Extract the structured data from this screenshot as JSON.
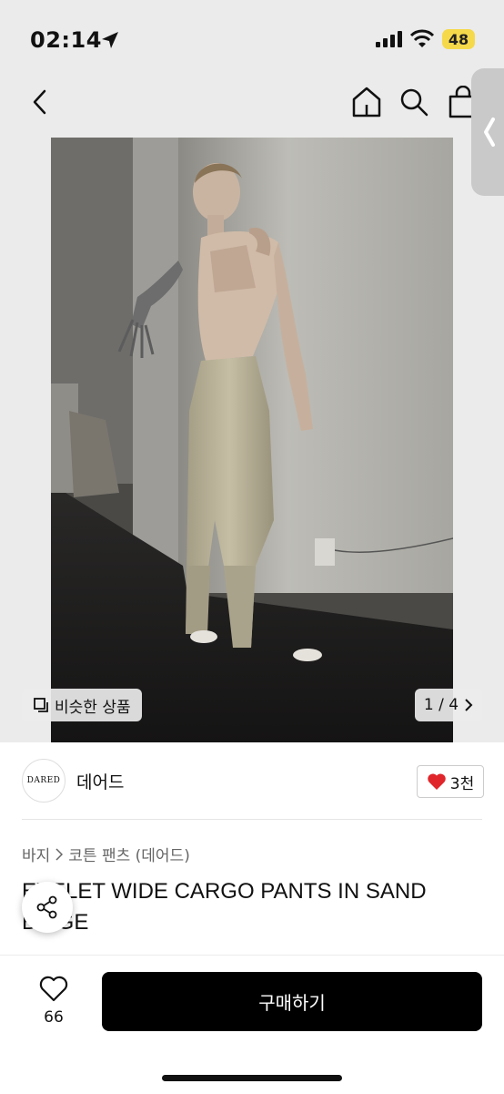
{
  "status_bar": {
    "time": "02:14",
    "battery": "48"
  },
  "overlay": {
    "similar_label": "비슷한 상품",
    "page_indicator": "1 / 4"
  },
  "brand": {
    "logo_text": "DARED",
    "name": "데어드",
    "likes": "3천"
  },
  "breadcrumb": {
    "category": "바지",
    "subcategory": "코튼 팬츠 (데어드)"
  },
  "product": {
    "title": "EYELET WIDE CARGO PANTS IN SAND BEIGE"
  },
  "bottom": {
    "wish_count": "66",
    "buy_label": "구매하기"
  },
  "colors": {
    "accent": "#000000",
    "heart": "#e0262b",
    "battery": "#f5d94b"
  }
}
